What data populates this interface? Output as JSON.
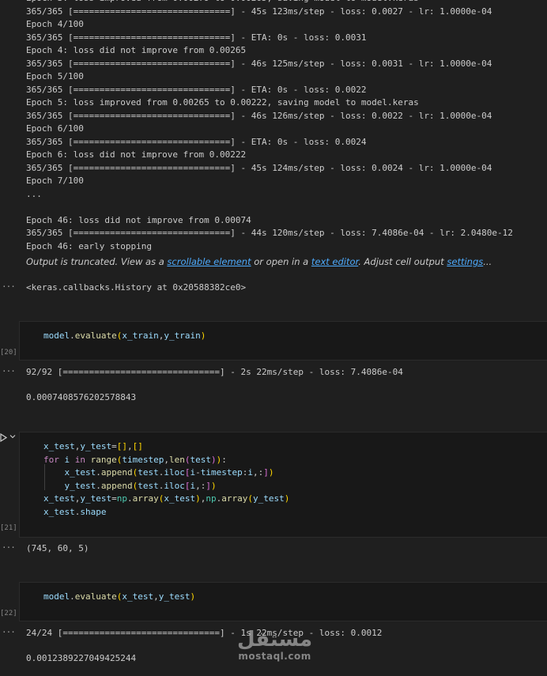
{
  "training_log": [
    "Epoch 3: loss improved from 0.00279 to 0.00265, saving model to model.keras",
    "365/365 [==============================] - 45s 123ms/step - loss: 0.0027 - lr: 1.0000e-04",
    "Epoch 4/100",
    "365/365 [==============================] - ETA: 0s - loss: 0.0031",
    "Epoch 4: loss did not improve from 0.00265",
    "365/365 [==============================] - 46s 125ms/step - loss: 0.0031 - lr: 1.0000e-04",
    "Epoch 5/100",
    "365/365 [==============================] - ETA: 0s - loss: 0.0022",
    "Epoch 5: loss improved from 0.00265 to 0.00222, saving model to model.keras",
    "365/365 [==============================] - 46s 126ms/step - loss: 0.0022 - lr: 1.0000e-04",
    "Epoch 6/100",
    "365/365 [==============================] - ETA: 0s - loss: 0.0024",
    "Epoch 6: loss did not improve from 0.00222",
    "365/365 [==============================] - 45s 124ms/step - loss: 0.0024 - lr: 1.0000e-04",
    "Epoch 7/100",
    "...",
    "",
    "Epoch 46: loss did not improve from 0.00074",
    "365/365 [==============================] - 44s 120ms/step - loss: 7.4086e-04 - lr: 2.0480e-12",
    "Epoch 46: early stopping"
  ],
  "truncation": {
    "prefix": "Output is truncated. View as a ",
    "link1": "scrollable element",
    "mid": " or open in a ",
    "link2": "text editor",
    "mid2": ". Adjust cell output ",
    "link3": "settings",
    "suffix": "..."
  },
  "history_output": "<keras.callbacks.History at 0x20588382ce0>",
  "cell20": {
    "exec_count": "[20]",
    "output_progress": "92/92 [==============================] - 2s 22ms/step - loss: 7.4086e-04",
    "output_value": "0.0007408576202578843"
  },
  "cell21": {
    "exec_count": "[21]",
    "output_value": "(745, 60, 5)"
  },
  "cell22": {
    "exec_count": "[22]",
    "output_progress": "24/24 [==============================] - 1s 22ms/step - loss: 0.0012",
    "output_value": "0.0012389227049425244"
  },
  "code_tokens": {
    "model": "model",
    "evaluate": "evaluate",
    "x_train": "x_train",
    "y_train": "y_train",
    "x_test": "x_test",
    "y_test": "y_test",
    "for": "for",
    "i": "i",
    "in": "in",
    "range": "range",
    "timestep": "timestep",
    "len": "len",
    "test": "test",
    "append": "append",
    "iloc": "iloc",
    "np": "np",
    "array": "array",
    "shape": "shape"
  },
  "ellipsis_glyph": "···",
  "run_icon": "play-icon",
  "chevron_icon": "chevron-down-icon",
  "watermark": {
    "arabic": "مستقل",
    "latin": "mostaql.com"
  }
}
